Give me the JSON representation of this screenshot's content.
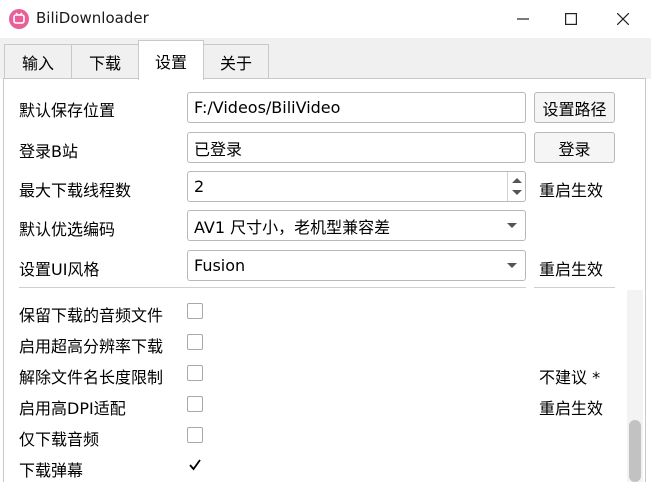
{
  "window": {
    "title": "BiliDownloader"
  },
  "tabs": [
    {
      "label": "输入"
    },
    {
      "label": "下载"
    },
    {
      "label": "设置"
    },
    {
      "label": "关于"
    }
  ],
  "settings": {
    "save_path": {
      "label": "默认保存位置",
      "value": "F:/Videos/BiliVideo",
      "button": "设置路径"
    },
    "login": {
      "label": "登录B站",
      "value": "已登录",
      "button": "登录"
    },
    "threads": {
      "label": "最大下载线程数",
      "value": "2",
      "note": "重启生效"
    },
    "codec": {
      "label": "默认优选编码",
      "value": "AV1 尺寸小，老机型兼容差"
    },
    "ui_style": {
      "label": "设置UI风格",
      "value": "Fusion",
      "note": "重启生效"
    }
  },
  "options": [
    {
      "label": "保留下载的音频文件",
      "checked": false,
      "note": ""
    },
    {
      "label": "启用超高分辨率下载",
      "checked": false,
      "note": ""
    },
    {
      "label": "解除文件名长度限制",
      "checked": false,
      "note": "不建议 *"
    },
    {
      "label": "启用高DPI适配",
      "checked": false,
      "note": "重启生效"
    },
    {
      "label": "仅下载音频",
      "checked": false,
      "note": ""
    },
    {
      "label": "下载弹幕",
      "checked": true,
      "note": ""
    }
  ],
  "colors": {
    "accent": "#e8609a",
    "tab_bg": "#f0f0f0",
    "border": "#c9c9c9"
  }
}
